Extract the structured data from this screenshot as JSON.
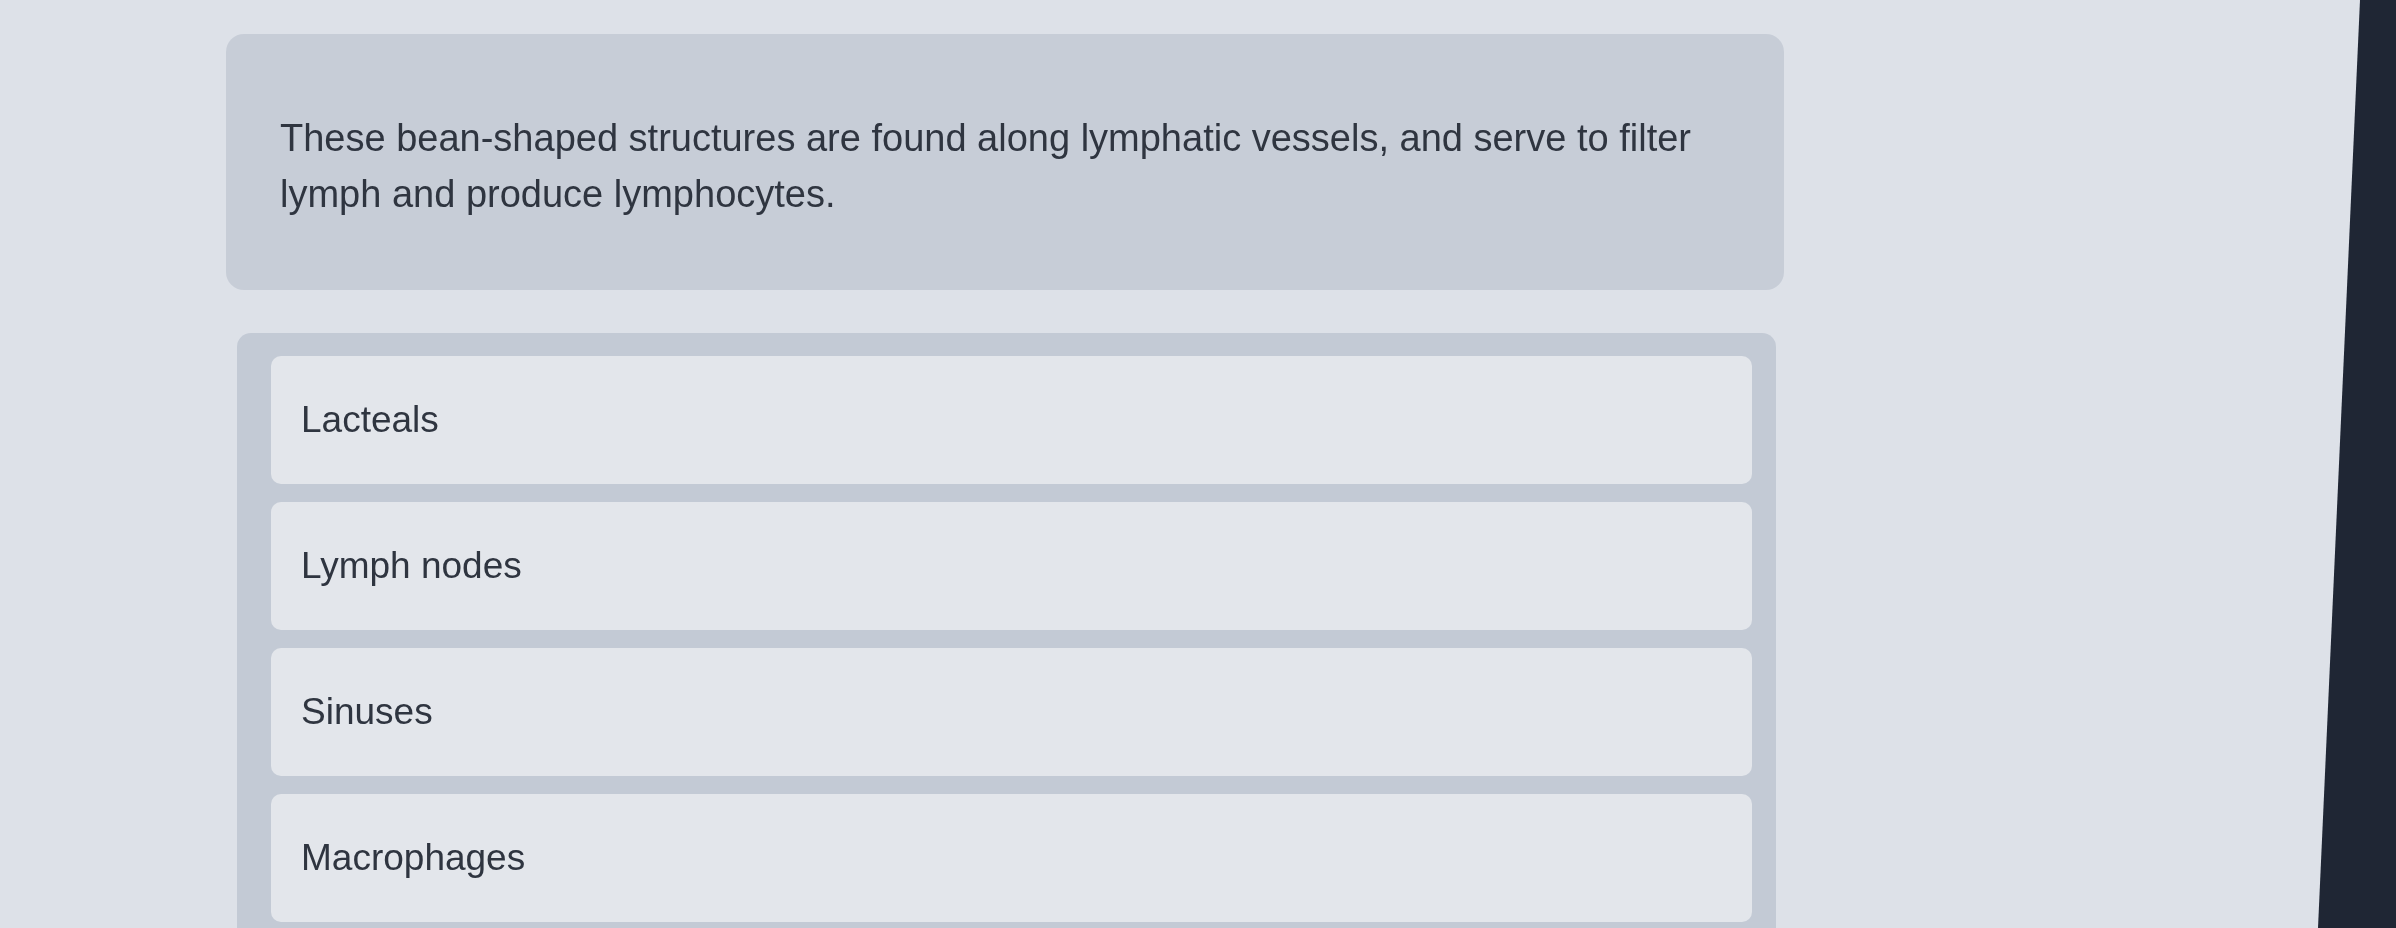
{
  "question": {
    "text": "These bean-shaped structures are found along lymphatic vessels, and serve to filter lymph and produce lymphocytes."
  },
  "options": [
    {
      "label": "Lacteals",
      "selected": false
    },
    {
      "label": "Lymph nodes",
      "selected": false
    },
    {
      "label": "Sinuses",
      "selected": false
    },
    {
      "label": "Macrophages",
      "selected": false
    }
  ]
}
